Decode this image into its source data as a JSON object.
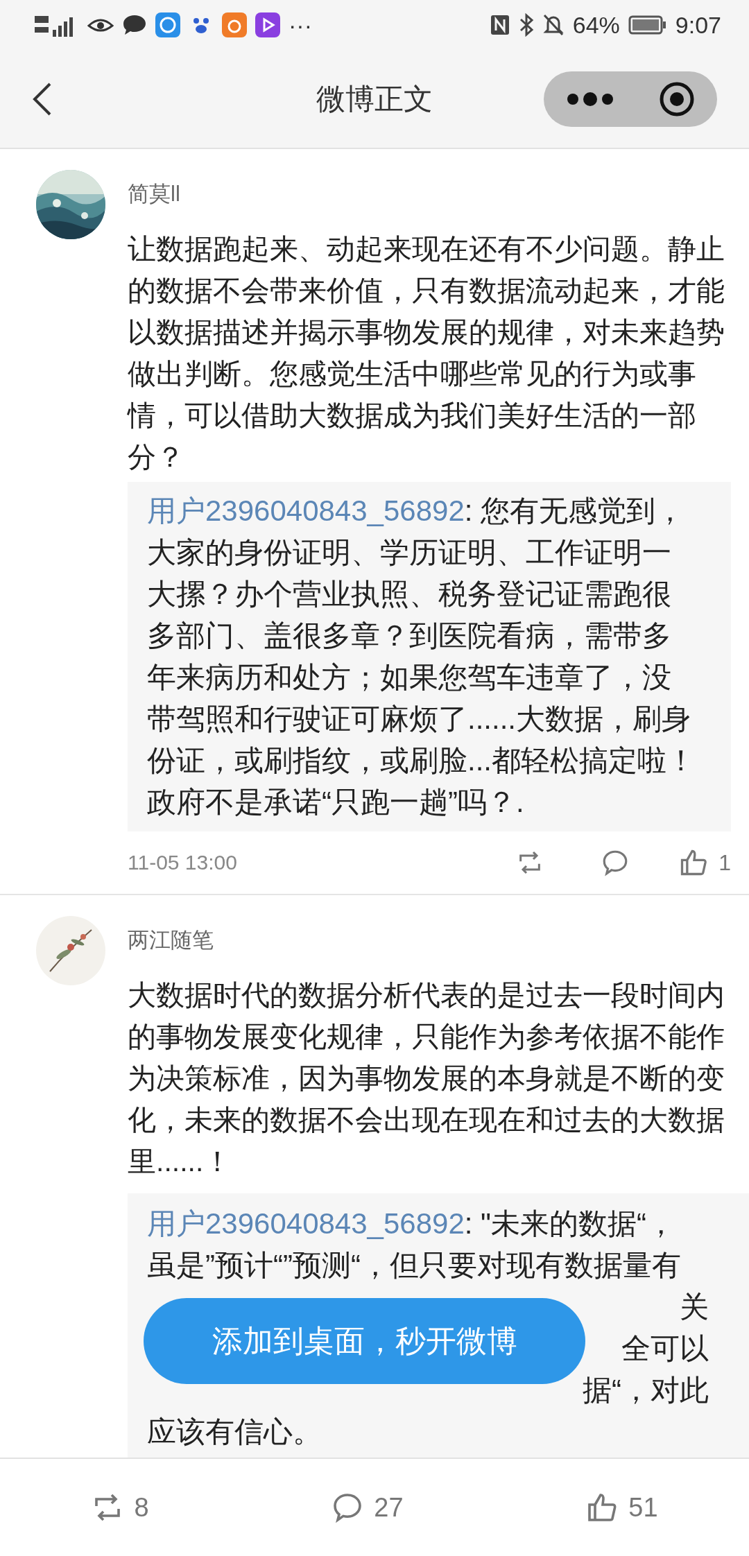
{
  "status_bar": {
    "battery": "64%",
    "time": "9:07",
    "more": "···"
  },
  "header": {
    "title": "微博正文"
  },
  "comments": [
    {
      "kind": "full",
      "author": "简莫ll",
      "text": "让数据跑起来、动起来现在还有不少问题。静止的数据不会带来价值，只有数据流动起来，才能以数据描述并揭示事物发展的规律，对未来趋势做出判断。您感觉生活中哪些常见的行为或事情，可以借助大数据成为我们美好生活的一部分？",
      "quote": {
        "user": "用户2396040843_56892",
        "text": ": 您有无感觉到，大家的身份证明、学历证明、工作证明一大摞？办个营业执照、税务登记证需跑很多部门、盖很多章？到医院看病，需带多年来病历和处方；如果您驾车违章了，没带驾照和行驶证可麻烦了......大数据，刷身份证，或刷指纹，或刷脸...都轻松搞定啦！政府不是承诺“只跑一趟”吗？."
      },
      "date": "11-05 13:00",
      "likes": "1"
    },
    {
      "kind": "cut",
      "author": "两江随笔",
      "text": "大数据时代的数据分析代表的是过去一段时间内的事物发展变化规律，只能作为参考依据不能作为决策标准，因为事物发展的本身就是不断的变化，未来的数据不会出现在现在和过去的大数据里......！",
      "quote": {
        "user": "用户2396040843_56892",
        "text": ": \"未来的数据“，虽是”预计“”预测“，但只要对现有数据量有",
        "fragments": [
          "关",
          "全可以",
          "据“，对此"
        ],
        "tail": "应该有信心。"
      }
    }
  ],
  "toast": "添加到桌面，秒开微博",
  "bottom_bar": {
    "reposts": "8",
    "comments": "27",
    "likes": "51"
  }
}
